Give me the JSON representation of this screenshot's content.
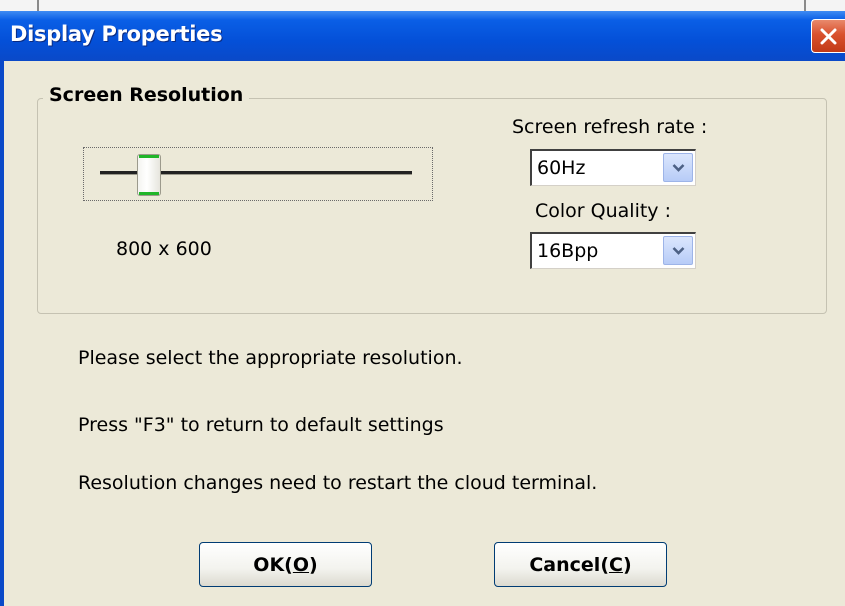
{
  "window": {
    "title": "Display Properties"
  },
  "group": {
    "legend": "Screen Resolution"
  },
  "slider": {
    "value_label": "800 x 600",
    "position_fraction": 0.16
  },
  "refresh": {
    "label": "Screen refresh rate :",
    "value": "60Hz"
  },
  "color_quality": {
    "label": "Color Quality :",
    "value": "16Bpp"
  },
  "messages": {
    "line1": "Please select the appropriate resolution.",
    "line2": "Press \"F3\" to return to default settings",
    "line3": "Resolution changes need to restart the cloud terminal."
  },
  "buttons": {
    "ok_prefix": "OK(",
    "ok_key": "O",
    "ok_suffix": ")",
    "cancel_prefix": "Cancel(",
    "cancel_key": "C",
    "cancel_suffix": ")"
  },
  "colors": {
    "titlebar": "#0450d8",
    "close": "#d9512e",
    "dialog_bg": "#ece9d8",
    "thumb_accent": "#21b629"
  },
  "icons": {
    "close": "close-x-icon",
    "dropdown": "chevron-down-icon"
  }
}
